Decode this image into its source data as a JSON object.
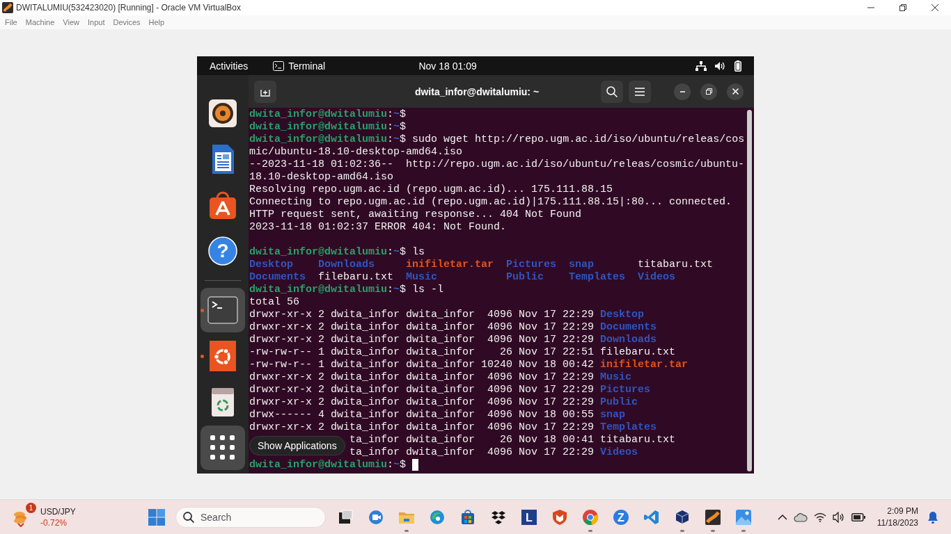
{
  "window": {
    "title": "DWITALUMIU(532423020) [Running] - Oracle VM VirtualBox"
  },
  "menu": [
    "File",
    "Machine",
    "View",
    "Input",
    "Devices",
    "Help"
  ],
  "guest": {
    "top_bar": {
      "activities": "Activities",
      "app": "Terminal",
      "clock": "Nov 18  01:09"
    },
    "dock": [
      [
        {
          "kind": "music",
          "running": false,
          "highlighted": false
        },
        {
          "kind": "document",
          "running": false,
          "highlighted": false
        },
        {
          "kind": "store",
          "running": false,
          "highlighted": false
        },
        {
          "kind": "help",
          "label": "?",
          "running": false,
          "highlighted": false
        }
      ],
      [
        {
          "kind": "terminal",
          "running": true,
          "highlighted": true
        },
        {
          "kind": "ubuntu",
          "running": true,
          "highlighted": false
        },
        {
          "kind": "trash",
          "running": false,
          "highlighted": false
        },
        {
          "kind": "apps-grid",
          "running": false,
          "highlighted": true
        }
      ]
    ],
    "tooltip": "Show Applications",
    "terminal": {
      "title": "dwita_infor@dwitalumiu: ~",
      "lines": [
        {
          "kind": "prompt",
          "host": "dwita_infor@dwitalumiu",
          "sep": ":",
          "path": "~",
          "symbol": "$"
        },
        {
          "kind": "prompt",
          "host": "dwita_infor@dwitalumiu",
          "sep": ":",
          "path": "~",
          "symbol": "$"
        },
        {
          "kind": "prompt",
          "host": "dwita_infor@dwitalumiu",
          "sep": ":",
          "path": "~",
          "symbol": "$",
          "command": "sudo wget http://repo.ugm.ac.id/iso/ubuntu/releas/cos"
        },
        {
          "kind": "output",
          "text": "mic/ubuntu-18.10-desktop-amd64.iso"
        },
        {
          "kind": "output",
          "text": "--2023-11-18 01:02:36--  http://repo.ugm.ac.id/iso/ubuntu/releas/cosmic/ubuntu-"
        },
        {
          "kind": "output",
          "text": "18.10-desktop-amd64.iso"
        },
        {
          "kind": "output",
          "text": "Resolving repo.ugm.ac.id (repo.ugm.ac.id)... 175.111.88.15"
        },
        {
          "kind": "output",
          "text": "Connecting to repo.ugm.ac.id (repo.ugm.ac.id)|175.111.88.15|:80... connected."
        },
        {
          "kind": "output",
          "text": "HTTP request sent, awaiting response... 404 Not Found"
        },
        {
          "kind": "output",
          "text": "2023-11-18 01:02:37 ERROR 404: Not Found."
        },
        {
          "kind": "blank"
        },
        {
          "kind": "prompt",
          "host": "dwita_infor@dwitalumiu",
          "sep": ":",
          "path": "~",
          "symbol": "$",
          "command": "ls"
        },
        {
          "kind": "listing",
          "columns": [
            [
              {
                "kind": "dir",
                "text": "Desktop"
              },
              {
                "kind": "dir",
                "text": "Documents"
              }
            ],
            [
              {
                "kind": "dir",
                "text": "Downloads"
              },
              {
                "kind": "file",
                "text": "filebaru.txt"
              }
            ],
            [
              {
                "kind": "archive",
                "text": "inifiletar.tar"
              },
              {
                "kind": "dir",
                "text": "Music"
              }
            ],
            [
              {
                "kind": "dir",
                "text": "Pictures"
              },
              {
                "kind": "dir",
                "text": "Public"
              }
            ],
            [
              {
                "kind": "dir",
                "text": "snap"
              },
              {
                "kind": "dir",
                "text": "Templates"
              }
            ],
            [
              {
                "kind": "file",
                "text": "titabaru.txt"
              },
              {
                "kind": "dir",
                "text": "Videos"
              }
            ]
          ]
        },
        {
          "kind": "prompt",
          "host": "dwita_infor@dwitalumiu",
          "sep": ":",
          "path": "~",
          "symbol": "$",
          "command": "ls -l"
        },
        {
          "kind": "output",
          "text": "total 56"
        },
        {
          "kind": "entry",
          "info": "drwxr-xr-x 2 dwita_infor dwita_infor  4096 Nov 17 22:29",
          "file": {
            "kind": "dir",
            "text": "Desktop"
          }
        },
        {
          "kind": "entry",
          "info": "drwxr-xr-x 2 dwita_infor dwita_infor  4096 Nov 17 22:29",
          "file": {
            "kind": "dir",
            "text": "Documents"
          }
        },
        {
          "kind": "entry",
          "info": "drwxr-xr-x 2 dwita_infor dwita_infor  4096 Nov 17 22:29",
          "file": {
            "kind": "dir",
            "text": "Downloads"
          }
        },
        {
          "kind": "entry",
          "info": "-rw-rw-r-- 1 dwita_infor dwita_infor    26 Nov 17 22:51",
          "file": {
            "kind": "file",
            "text": "filebaru.txt"
          }
        },
        {
          "kind": "entry",
          "info": "-rw-rw-r-- 1 dwita_infor dwita_infor 10240 Nov 18 00:42",
          "file": {
            "kind": "archive",
            "text": "inifiletar.tar"
          }
        },
        {
          "kind": "entry",
          "info": "drwxr-xr-x 2 dwita_infor dwita_infor  4096 Nov 17 22:29",
          "file": {
            "kind": "dir",
            "text": "Music"
          }
        },
        {
          "kind": "entry",
          "info": "drwxr-xr-x 2 dwita_infor dwita_infor  4096 Nov 17 22:29",
          "file": {
            "kind": "dir",
            "text": "Pictures"
          }
        },
        {
          "kind": "entry",
          "info": "drwxr-xr-x 2 dwita_infor dwita_infor  4096 Nov 17 22:29",
          "file": {
            "kind": "dir",
            "text": "Public"
          }
        },
        {
          "kind": "entry",
          "info": "drwx------ 4 dwita_infor dwita_infor  4096 Nov 18 00:55",
          "file": {
            "kind": "dir",
            "text": "snap"
          }
        },
        {
          "kind": "entry",
          "info": "drwxr-xr-x 2 dwita_infor dwita_infor  4096 Nov 17 22:29",
          "file": {
            "kind": "dir",
            "text": "Templates"
          }
        },
        {
          "kind": "entry",
          "covered": true,
          "info": "ta_infor dwita_infor    26 Nov 18 00:41",
          "file": {
            "kind": "file",
            "text": "titabaru.txt"
          }
        },
        {
          "kind": "entry",
          "covered": true,
          "info": "ta_infor dwita_infor  4096 Nov 17 22:29",
          "file": {
            "kind": "dir",
            "text": "Videos"
          }
        },
        {
          "kind": "prompt",
          "host": "dwita_infor@dwitalumiu",
          "sep": ":",
          "path": "~",
          "symbol": "$",
          "cursor": true
        }
      ]
    }
  },
  "taskbar": {
    "widget": {
      "badge": "1",
      "label": "USD/JPY",
      "change": "-0.72%"
    },
    "search": {
      "placeholder": "Search"
    },
    "apps": [
      {
        "kind": "task-view",
        "running": false
      },
      {
        "kind": "meet",
        "running": false
      },
      {
        "kind": "folder",
        "running": true
      },
      {
        "kind": "edge",
        "running": false
      },
      {
        "kind": "store",
        "running": false
      },
      {
        "kind": "dropbox",
        "running": false
      },
      {
        "kind": "letter",
        "label": "L",
        "running": false
      },
      {
        "kind": "shield",
        "running": false
      },
      {
        "kind": "chrome",
        "running": true
      },
      {
        "kind": "zapp",
        "label": "Z",
        "running": false
      },
      {
        "kind": "vscode",
        "running": false
      },
      {
        "kind": "vbox",
        "running": true
      },
      {
        "kind": "orange-app",
        "running": true
      },
      {
        "kind": "photos",
        "running": true
      }
    ],
    "clock": {
      "time": "2:09 PM",
      "date": "11/18/2023"
    }
  }
}
